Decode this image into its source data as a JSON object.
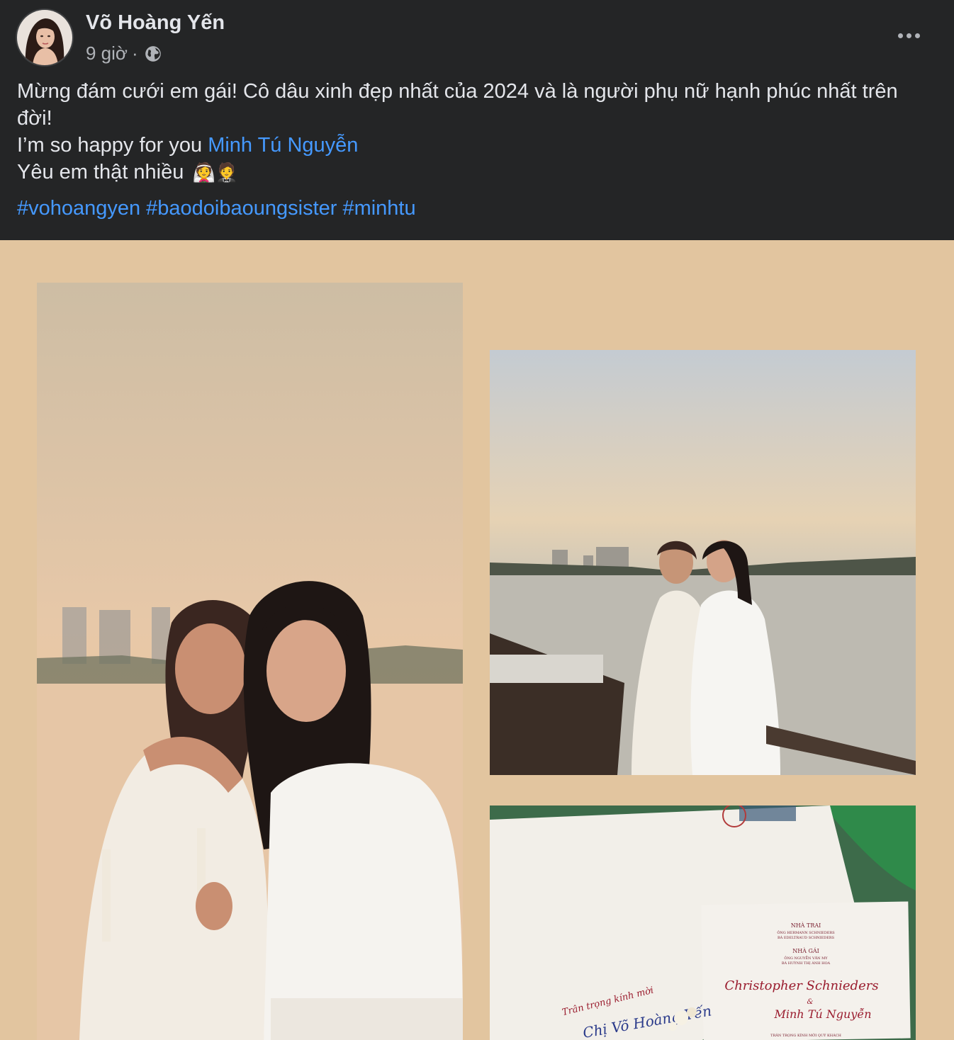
{
  "post": {
    "author": "Võ Hoàng Yến",
    "time": "9 giờ",
    "separator": "·",
    "privacy_icon": "globe-icon",
    "more_icon": "more-horizontal-icon",
    "lines": [
      "Mừng đám cưới em gái! Cô dâu xinh đẹp nhất của 2024 và là người phụ nữ hạnh phúc nhất trên đời!",
      "I’m so happy for you ",
      "Yêu em thật nhiều"
    ],
    "mention": "Minh Tú Nguyễn",
    "emojis": "👰🤵",
    "hashtags": [
      "#vohoangyen",
      "#baodoibaoungsister",
      "#minhtu"
    ]
  },
  "invitation": {
    "groom_side_label": "NHÀ TRAI",
    "groom_parent_1": "ÔNG HERMANN SCHNIEDERS",
    "groom_parent_2": "BÀ EDELTRAUD SCHNIEDERS",
    "bride_side_label": "NHÀ GÁI",
    "bride_parent_1": "ÔNG NGUYỄN VĂN MY",
    "bride_parent_2": "BÀ HUỲNH THỊ ÁNH HOA",
    "groom_name": "Christopher Schnieders",
    "ampersand": "&",
    "bride_name": "Minh Tú Nguyễn",
    "invite_line": "Trân trọng kính mời",
    "guest_name": "Chị Võ Hoàng Yến",
    "footer_line": "TRÂN TRỌNG KÍNH MỜI QUÝ KHÁCH"
  },
  "colors": {
    "background": "#242526",
    "text": "#e4e6eb",
    "secondary_text": "#b0b3b8",
    "link": "#4599ff",
    "media_background": "#e2c59f"
  }
}
